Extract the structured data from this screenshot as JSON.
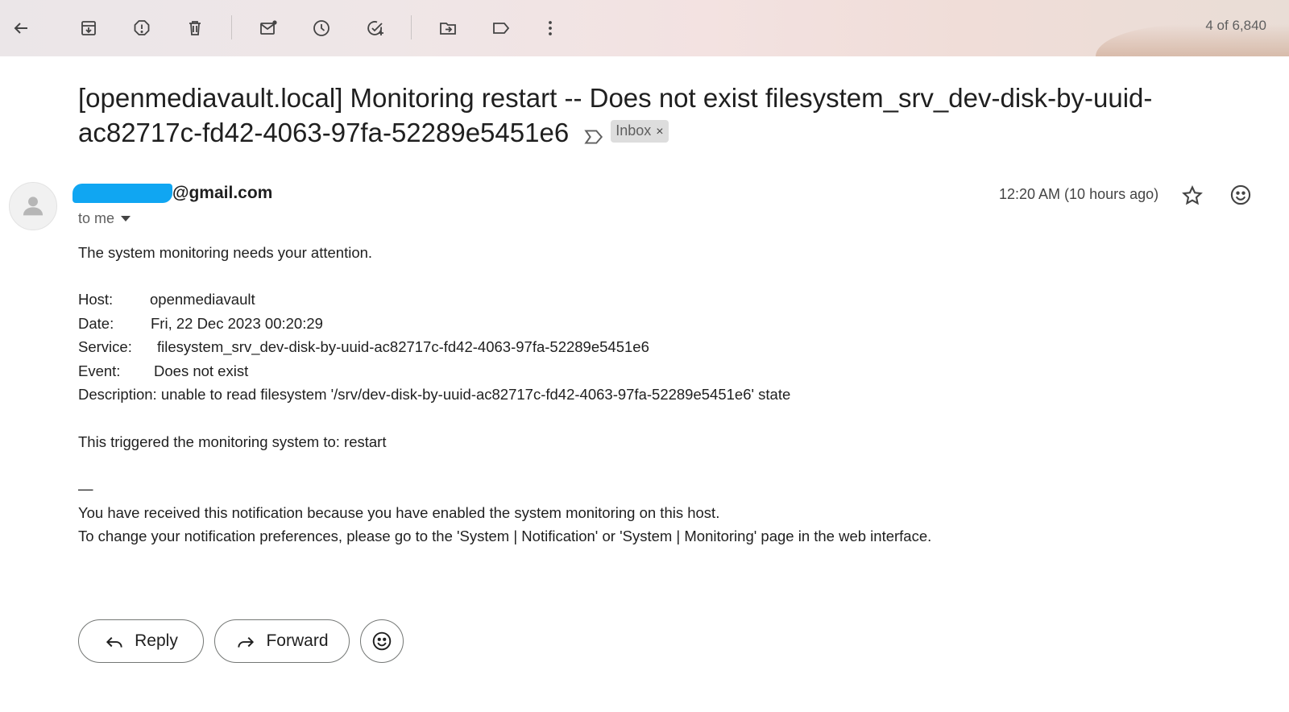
{
  "toolbar": {
    "icons": [
      "back-arrow-icon",
      "archive-icon",
      "report-spam-icon",
      "delete-icon",
      "mark-unread-icon",
      "snooze-icon",
      "add-to-tasks-icon",
      "move-to-icon",
      "label-icon",
      "more-vert-icon"
    ],
    "counter": "4 of 6,840"
  },
  "email": {
    "subject": "[openmediavault.local] Monitoring restart -- Does not exist filesystem_srv_dev-disk-by-uuid-ac82717c-fd42-4063-97fa-52289e5451e6",
    "label": "Inbox",
    "label_close": "×",
    "sender_suffix": "@gmail.com",
    "recipient": "to me",
    "timestamp": "12:20 AM (10 hours ago)",
    "body": {
      "intro": "The system monitoring needs your attention.",
      "host_label": "Host:",
      "host_value": "openmediavault",
      "date_label": "Date:",
      "date_value": "Fri, 22 Dec 2023 00:20:29",
      "service_label": "Service:",
      "service_value": "filesystem_srv_dev-disk-by-uuid-ac82717c-fd42-4063-97fa-52289e5451e6",
      "event_label": "Event:",
      "event_value": "Does not exist",
      "description": "Description: unable to read filesystem '/srv/dev-disk-by-uuid-ac82717c-fd42-4063-97fa-52289e5451e6' state",
      "triggered": "This triggered the monitoring system to: restart",
      "separator": "—",
      "footer1": "You have received this notification because you have enabled the system monitoring on this host.",
      "footer2": "To change your notification preferences, please go to the 'System | Notification' or 'System | Monitoring' page in the web interface."
    }
  },
  "actions": {
    "reply": "Reply",
    "forward": "Forward"
  },
  "colors": {
    "redaction": "#10a6f2",
    "chip_bg": "#dddddd",
    "text": "#1f1f1f",
    "muted": "#5f5f5f"
  }
}
